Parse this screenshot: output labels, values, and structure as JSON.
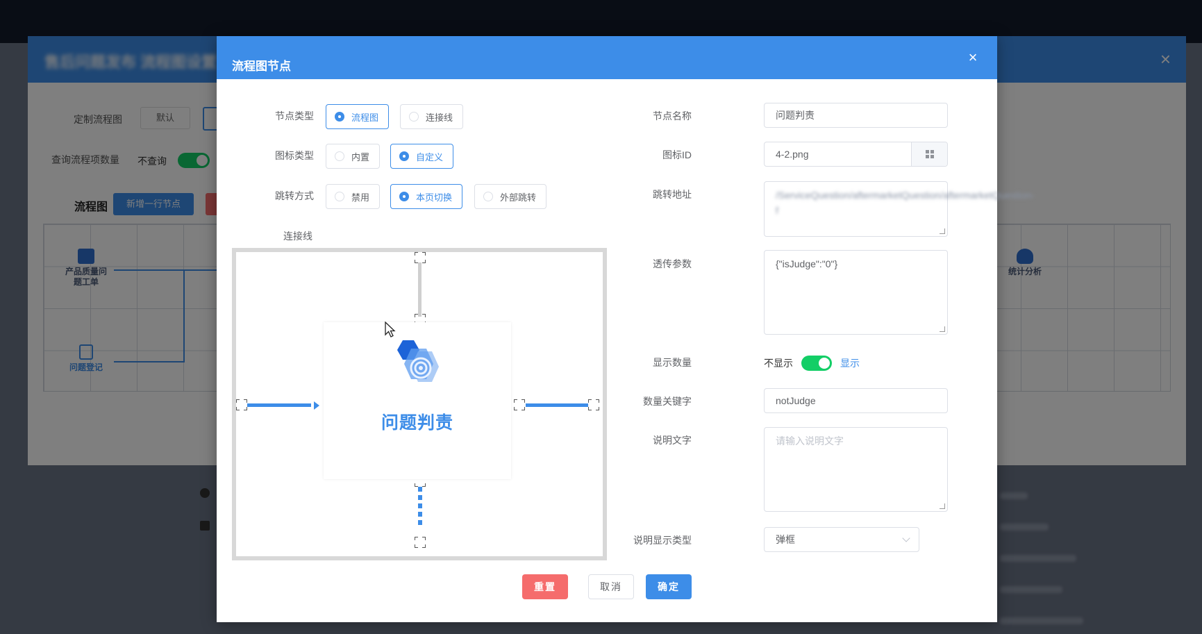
{
  "background_app": {
    "dialog_title": "售后问题发布 流程图设置",
    "custom_flow_label": "定制流程图",
    "default_label": "默认",
    "query_count_label": "查询流程项数量",
    "query_switch_text": "不查询",
    "flow_section_title": "流程图",
    "add_row_button": "新增一行节点",
    "nodes": [
      {
        "label": "产品质量问题工单"
      },
      {
        "label": "问题登记"
      },
      {
        "label": "统计分析"
      }
    ],
    "close_icon": "×"
  },
  "modal": {
    "title": "流程图节点",
    "close_icon": "×",
    "node_type": {
      "label": "节点类型",
      "options": [
        "流程图",
        "连接线"
      ],
      "selected": "流程图"
    },
    "icon_type": {
      "label": "图标类型",
      "options": [
        "内置",
        "自定义"
      ],
      "selected": "自定义"
    },
    "jump_mode": {
      "label": "跳转方式",
      "options": [
        "禁用",
        "本页切换",
        "外部跳转"
      ],
      "selected": "本页切换"
    },
    "connector_label": "连接线",
    "preview_node_name": "问题判责",
    "node_name": {
      "label": "节点名称",
      "value": "问题判责"
    },
    "icon_id": {
      "label": "图标ID",
      "value": "4-2.png",
      "suffix_icon": "grid-icon"
    },
    "jump_url": {
      "label": "跳转地址",
      "value": "/ServiceQuestion/aftermarketQuestion/aftermarketQuestion-f"
    },
    "pass_params": {
      "label": "透传参数",
      "value": "{\"isJudge\":\"0\"}"
    },
    "show_count": {
      "label": "显示数量",
      "off_text": "不显示",
      "on_text": "显示",
      "value": true
    },
    "count_key": {
      "label": "数量关键字",
      "value": "notJudge"
    },
    "description": {
      "label": "说明文字",
      "placeholder": "请输入说明文字"
    },
    "desc_display_type": {
      "label": "说明显示类型",
      "value": "弹框"
    },
    "buttons": {
      "reset": "重置",
      "cancel": "取消",
      "ok": "确定"
    }
  },
  "colors": {
    "primary": "#3d8de8",
    "danger": "#f56c6c",
    "success": "#13ce66"
  }
}
